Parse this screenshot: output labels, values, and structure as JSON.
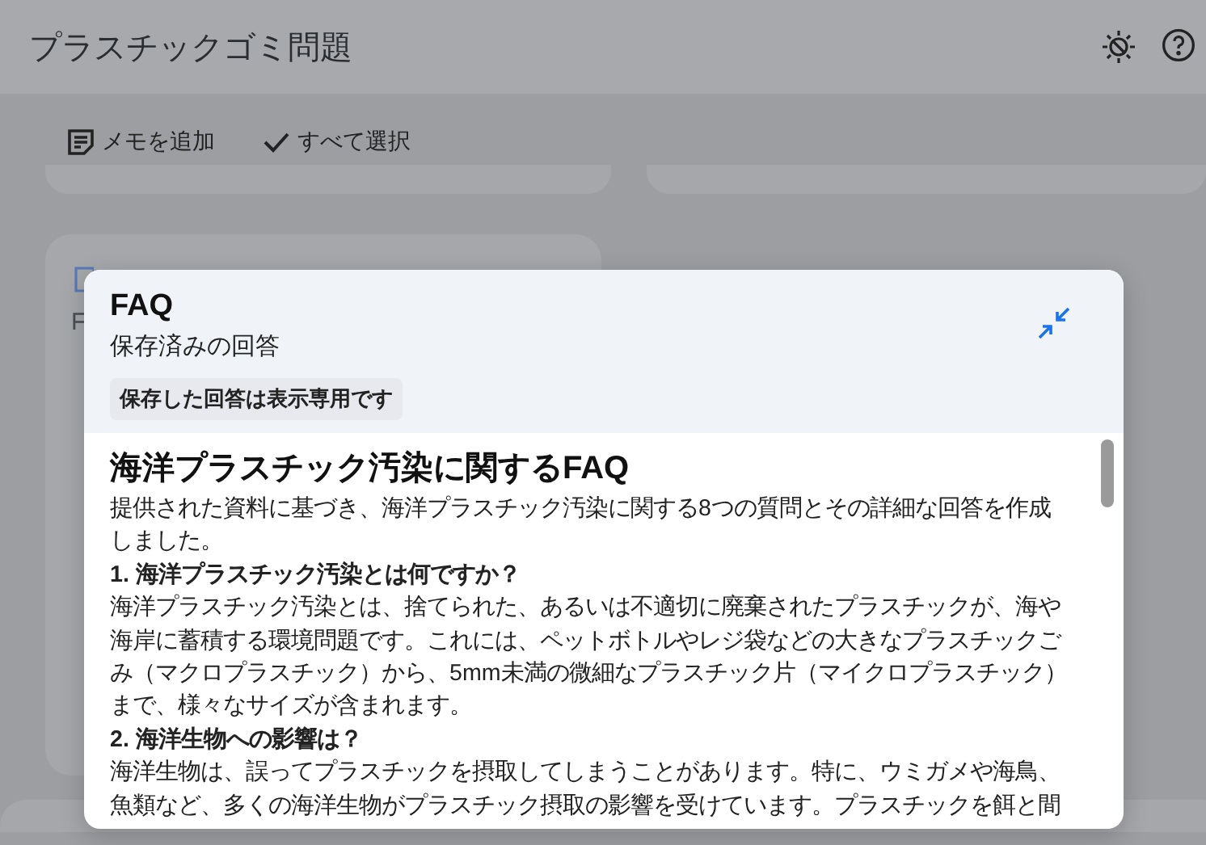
{
  "app_bar": {
    "title": "プラスチックゴミ問題"
  },
  "toolbar": {
    "buttons": [
      {
        "kind": "note",
        "label": "メモを追加"
      },
      {
        "kind": "check",
        "label": "すべて選択"
      }
    ]
  },
  "background_card": {
    "label": "F"
  },
  "dialog": {
    "title": "FAQ",
    "subtitle": "保存済みの回答",
    "notice": "保存した回答は表示専用です",
    "content": [
      {
        "kind": "heading",
        "text": "海洋プラスチック汚染に関するFAQ"
      },
      {
        "kind": "paragraph",
        "text": "提供された資料に基づき、海洋プラスチック汚染に関する8つの質問とその詳細な回答を作成しました。"
      },
      {
        "kind": "question",
        "text": "1. 海洋プラスチック汚染とは何ですか？"
      },
      {
        "kind": "paragraph",
        "text": "海洋プラスチック汚染とは、捨てられた、あるいは不適切に廃棄されたプラスチックが、海や海岸に蓄積する環境問題です。これには、ペットボトルやレジ袋などの大きなプラスチックごみ（マクロプラスチック）から、5mm未満の微細なプラスチック片（マイクロプラスチック）まで、様々なサイズが含まれます。"
      },
      {
        "kind": "question",
        "text": "2. 海洋生物への影響は？"
      },
      {
        "kind": "paragraph",
        "text": "海洋生物は、誤ってプラスチックを摂取してしまうことがあります。特に、ウミガメや海鳥、魚類など、多くの海洋生物がプラスチック摂取の影響を受けています。プラスチックを餌と間"
      }
    ]
  }
}
